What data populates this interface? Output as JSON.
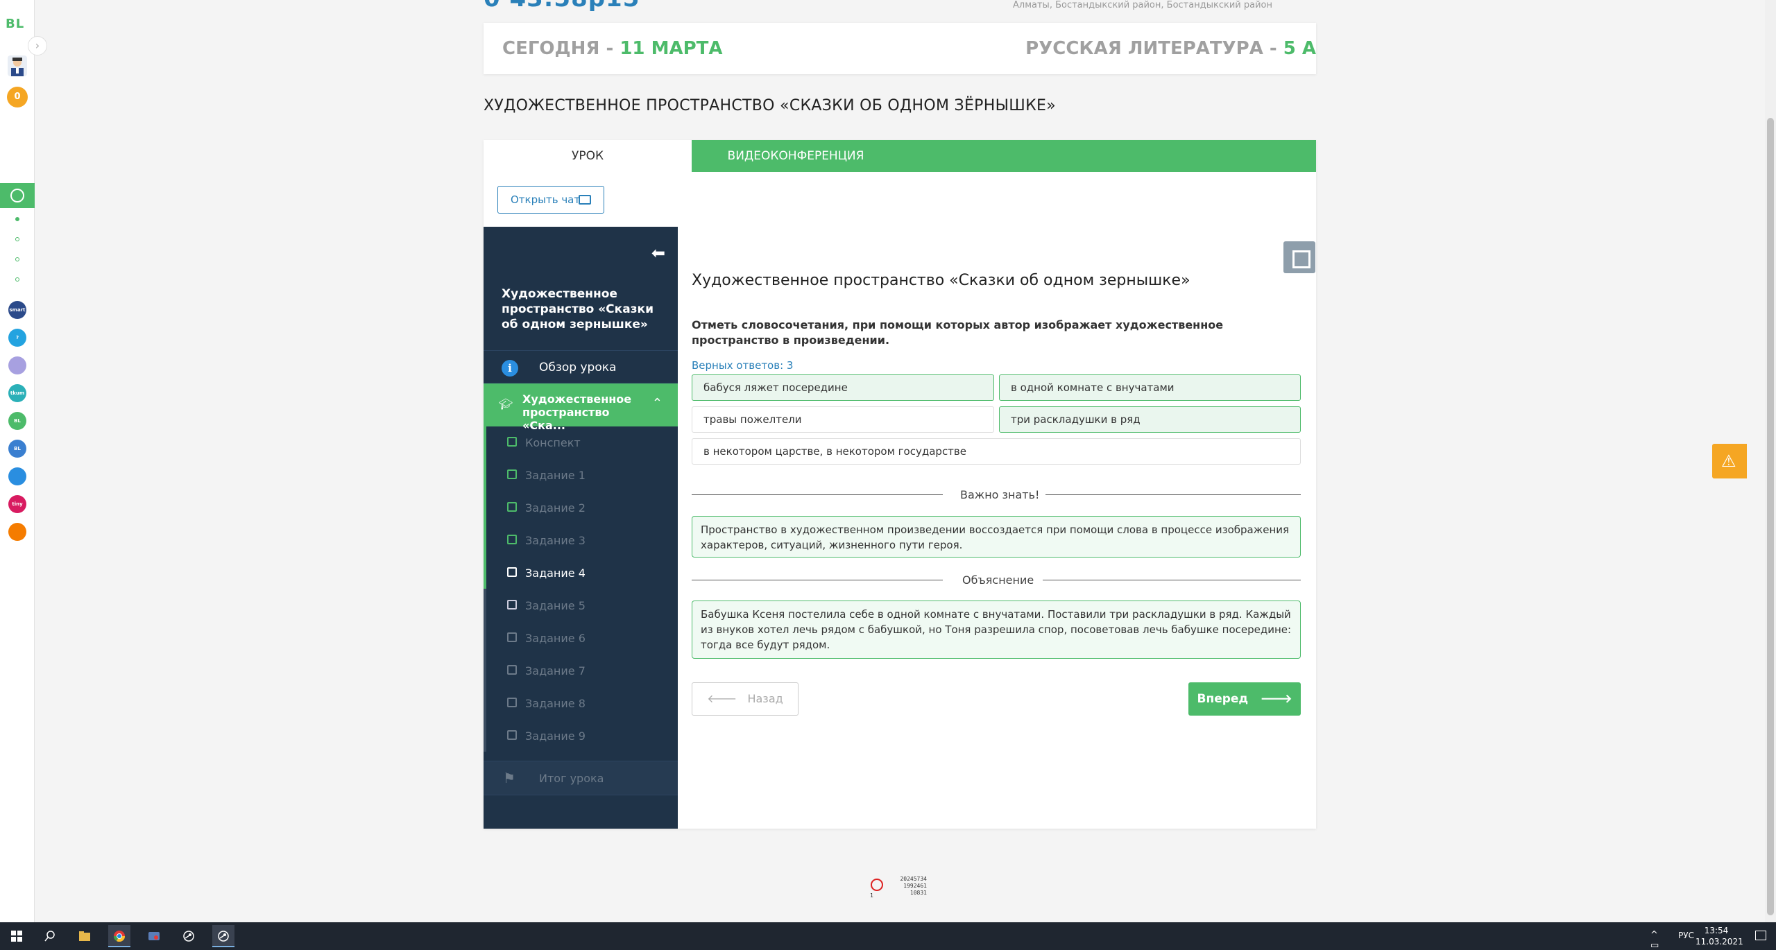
{
  "header": {
    "time_fragment": "0 43:58p15",
    "location": "Алматы, Бостандыкский район, Бостандыкский район"
  },
  "date_card": {
    "today_label": "СЕГОДНЯ - ",
    "today_date": "11 МАРТА",
    "subject_label": "РУССКАЯ ЛИТЕРАТУРА - ",
    "class_name": "5 А"
  },
  "rail": {
    "logo": "BL",
    "coins": "0",
    "apps": [
      {
        "label": "smart",
        "color": "#2b4a8a"
      },
      {
        "label": "?",
        "color": "#23a3e0"
      },
      {
        "label": "",
        "color": "#a7a0e0"
      },
      {
        "label": "tkum",
        "color": "#2bb0b8"
      },
      {
        "label": "BL",
        "color": "#4dbb6a"
      },
      {
        "label": "BL",
        "color": "#3a7fd0"
      },
      {
        "label": "",
        "color": "#2a8ee0"
      },
      {
        "label": "tiny",
        "color": "#d81b60"
      },
      {
        "label": "",
        "color": "#f57c00"
      }
    ]
  },
  "lesson": {
    "title": "ХУДОЖЕСТВЕННОЕ ПРОСТРАНСТВО «СКАЗКИ ОБ ОДНОМ ЗЁРНЫШКЕ»"
  },
  "tabs": {
    "lesson": "УРОК",
    "video": "ВИДЕОКОНФЕРЕНЦИЯ"
  },
  "chat_button": "Открыть чат",
  "sidebar": {
    "title": "Художественное пространство «Сказки об одном зернышке»",
    "overview": "Обзор урока",
    "section": "Художественное пространство «Ска...",
    "items": [
      {
        "label": "Конспект"
      },
      {
        "label": "Задание 1"
      },
      {
        "label": "Задание 2"
      },
      {
        "label": "Задание 3"
      },
      {
        "label": "Задание 4"
      },
      {
        "label": "Задание 5"
      },
      {
        "label": "Задание 6"
      },
      {
        "label": "Задание 7"
      },
      {
        "label": "Задание 8"
      },
      {
        "label": "Задание 9"
      }
    ],
    "final": "Итог урока"
  },
  "task": {
    "title": "Художественное пространство «Сказки об одном зернышке»",
    "question": "Отметь словосочетания, при помощи которых автор изображает художественное пространство в произведении.",
    "correct_count": "Верных ответов: 3",
    "options": [
      {
        "text": "бабуся ляжет посередине",
        "correct": true
      },
      {
        "text": "в одной комнате с внучатами",
        "correct": true
      },
      {
        "text": "травы пожелтели",
        "correct": false
      },
      {
        "text": "три раскладушки в ряд",
        "correct": true
      },
      {
        "text": "в некотором царстве, в некотором государстве",
        "correct": false
      }
    ],
    "important_label": "Важно знать!",
    "important_text": "Пространство в художественном произведении воссоздается при помощи слова в процессе изображения характеров, ситуаций, жизненного пути героя.",
    "explanation_label": "Объяснение",
    "explanation_text": "Бабушка Ксеня постелила себе в одной комнате с внучатами. Поставили три раскладушки в ряд. Каждый из внуков хотел лечь рядом с бабушкой, но Тоня разрешила спор, посоветовав лечь бабушке посередине: тогда все будут рядом.",
    "back": "Назад",
    "next": "Вперед"
  },
  "counter": {
    "line1": "20245734",
    "line2": "1992461",
    "line3": "10831",
    "extra": "1"
  },
  "taskbar": {
    "lang": "РУС",
    "time": "13:54",
    "date": "11.03.2021"
  },
  "colors": {
    "accent": "#4dbb6a",
    "link": "#2a80b9",
    "sidebar_bg": "#1f3348",
    "warning": "#f5a623"
  }
}
